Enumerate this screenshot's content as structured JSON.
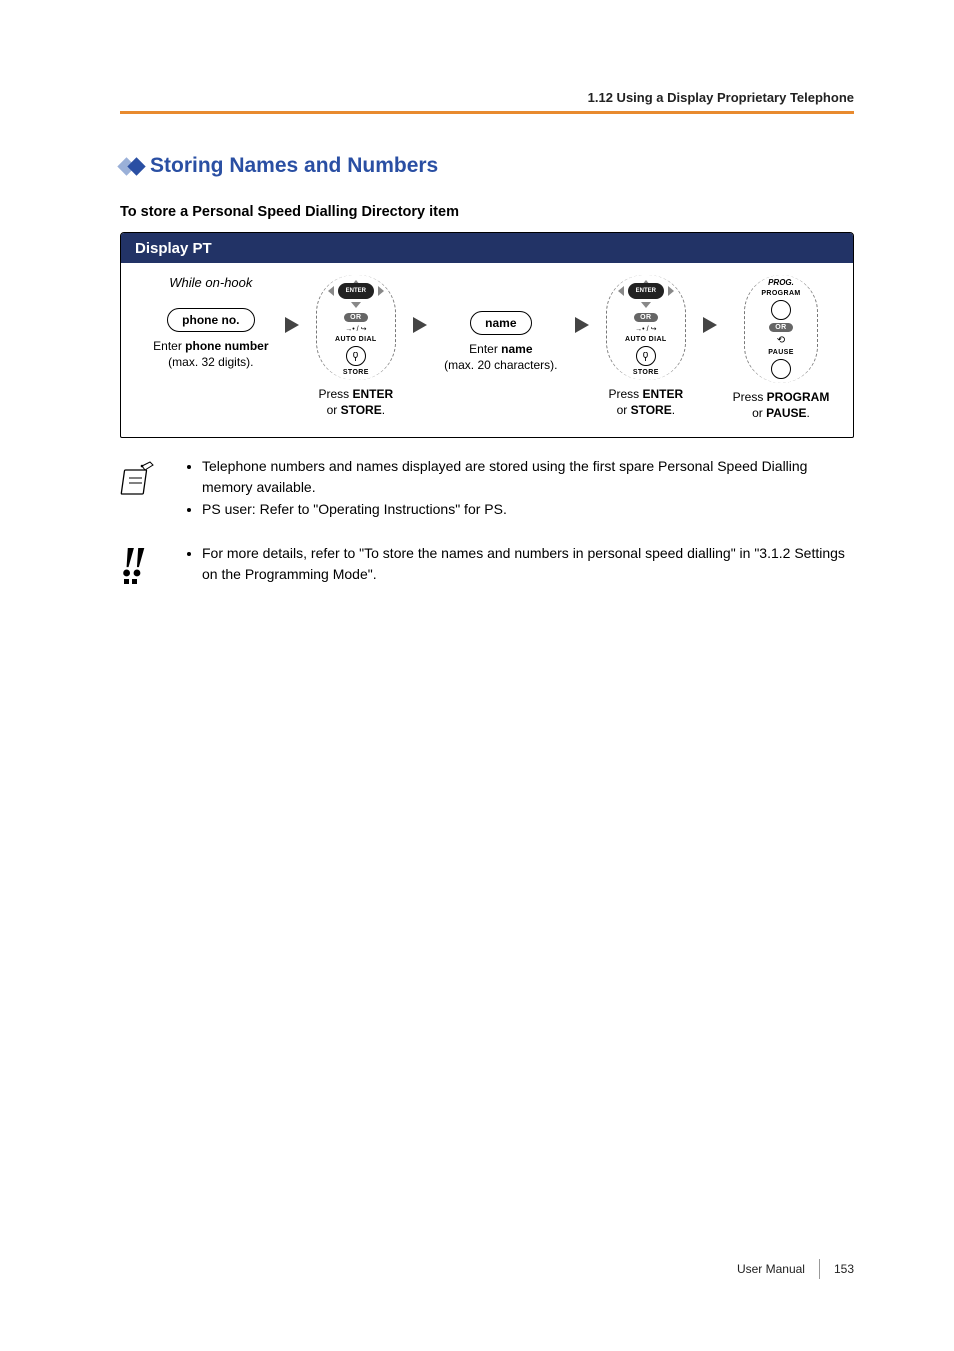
{
  "header": {
    "section_ref": "1.12 Using a Display Proprietary Telephone"
  },
  "title": "Storing Names and Numbers",
  "sub_heading": "To store a Personal Speed Dialling Directory item",
  "flow": {
    "header": "Display PT",
    "prelude": "While on-hook",
    "step1": {
      "pill": "phone no.",
      "line1": "Enter ",
      "bold1": "phone number",
      "line2": "(max. 32 digits)."
    },
    "enter_label": "ENTER",
    "or_label": "OR",
    "autodial_label": "AUTO DIAL",
    "store_label": "STORE",
    "step2": {
      "line1": "Press ",
      "bold1": "ENTER",
      "line2": "or ",
      "bold2": "STORE",
      "line3": "."
    },
    "step3": {
      "pill": "name",
      "line1": "Enter ",
      "bold1": "name",
      "line2": "(max. 20 characters)."
    },
    "step4": {
      "line1": "Press ",
      "bold1": "ENTER",
      "line2": "or ",
      "bold2": "STORE",
      "line3": "."
    },
    "prog_label1": "PROG.",
    "prog_label2": "PROGRAM",
    "pause_label": "PAUSE",
    "step5": {
      "line1": "Press ",
      "bold1": "PROGRAM",
      "line2": "or ",
      "bold2": "PAUSE",
      "line3": "."
    }
  },
  "notes1": {
    "item1": "Telephone numbers and names displayed are stored using the first spare Personal Speed Dialling memory available.",
    "item2": "PS user: Refer to \"Operating Instructions\" for PS."
  },
  "notes2": {
    "item1": "For more details, refer to \"To store the names and numbers in personal speed dialling\" in \"3.1.2 Settings on the Programming Mode\"."
  },
  "footer": {
    "label": "User Manual",
    "page": "153"
  }
}
